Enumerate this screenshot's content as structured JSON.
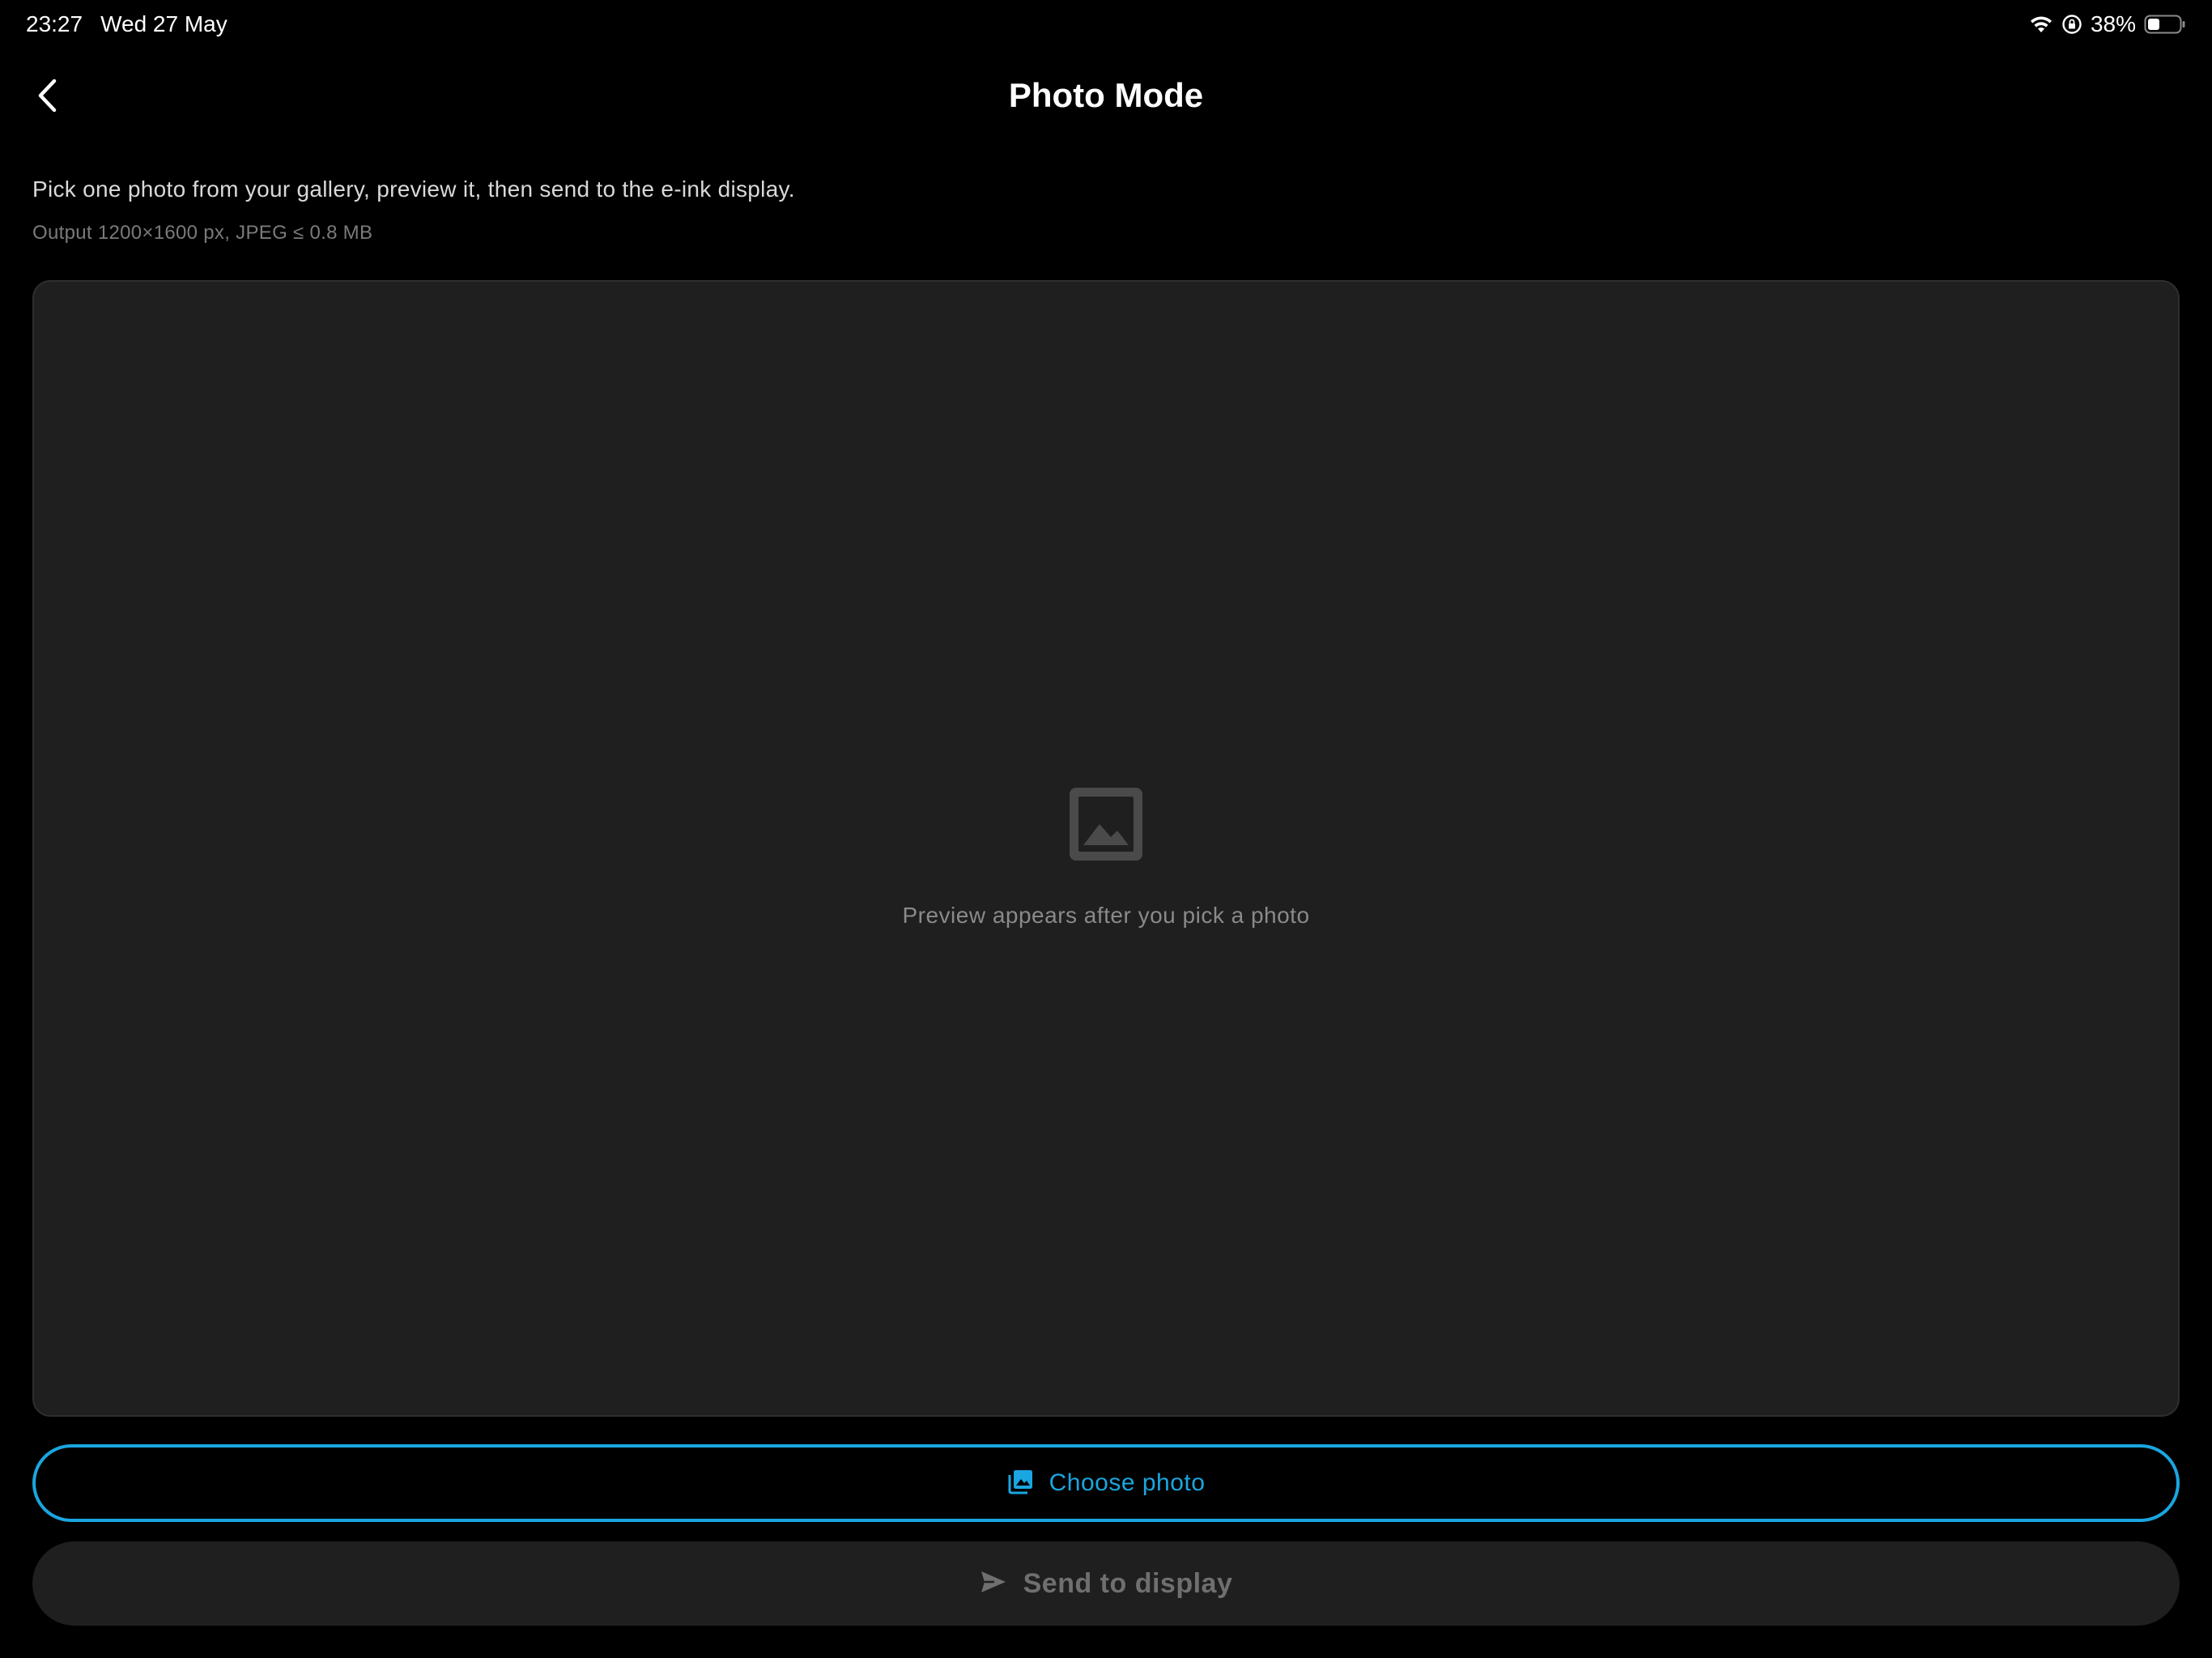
{
  "status_bar": {
    "time": "23:27",
    "date": "Wed 27 May",
    "battery_percent": "38%",
    "battery_level": 0.38,
    "wifi_icon": "wifi-icon",
    "orientation_lock_icon": "orientation-lock-icon",
    "battery_icon": "battery-icon"
  },
  "header": {
    "back_icon": "chevron-left-icon",
    "title": "Photo Mode"
  },
  "intro": {
    "description": "Pick one photo from your gallery, preview it, then send to the e-ink display.",
    "output_note": "Output 1200×1600 px, JPEG ≤ 0.8 MB"
  },
  "preview": {
    "placeholder_icon": "image-placeholder-icon",
    "placeholder_text": "Preview appears after you pick a photo"
  },
  "actions": {
    "choose_icon": "photo-library-icon",
    "choose_label": "Choose photo",
    "send_icon": "send-icon",
    "send_label": "Send to display"
  },
  "colors": {
    "background": "#000000",
    "panel": "#1f1f1f",
    "accent": "#1aa6e0",
    "disabled_text": "#6f6f6f"
  }
}
